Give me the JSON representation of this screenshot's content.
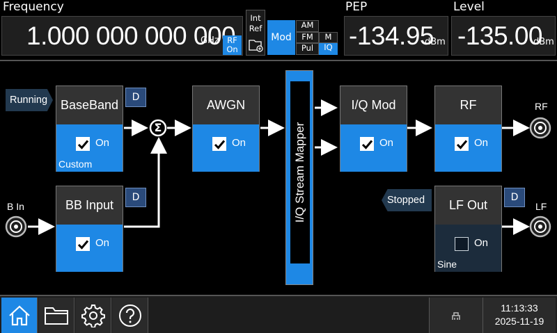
{
  "header": {
    "frequency": {
      "label": "Frequency",
      "value": "1.000 000 000 000",
      "unit": "GHz"
    },
    "rf_state": {
      "line1": "RF",
      "line2": "On"
    },
    "ref": {
      "line1": "Int",
      "line2": "Ref"
    },
    "mod": {
      "label": "Mod",
      "am": "AM",
      "fm": "FM",
      "pul": "Pul",
      "m": "M",
      "iq": "IQ"
    },
    "pep": {
      "label": "PEP",
      "value": "-134.95",
      "unit": "dBm"
    },
    "level": {
      "label": "Level",
      "value": "-135.00",
      "unit": "dBm"
    }
  },
  "diagram": {
    "baseband": {
      "title": "BaseBand",
      "state": "On",
      "sub": "Custom",
      "d": "D",
      "status": "Running"
    },
    "bbinput": {
      "title": "BB Input",
      "state": "On",
      "d": "D"
    },
    "awgn": {
      "title": "AWGN",
      "state": "On"
    },
    "mapper": {
      "title": "I/Q Stream Mapper"
    },
    "iqmod": {
      "title": "I/Q Mod",
      "state": "On"
    },
    "rf": {
      "title": "RF",
      "state": "On"
    },
    "lfout": {
      "title": "LF Out",
      "state": "On",
      "sub": "Sine",
      "d": "D",
      "status": "Stopped"
    },
    "ports": {
      "bin": "B In",
      "rf": "RF",
      "lf": "LF"
    },
    "sum_symbol": "Σ"
  },
  "taskbar": {
    "time": "11:13:33",
    "date": "2025-11-19"
  },
  "colors": {
    "accent": "#1e88e5",
    "block_title": "#333333",
    "tag": "#22394f"
  }
}
